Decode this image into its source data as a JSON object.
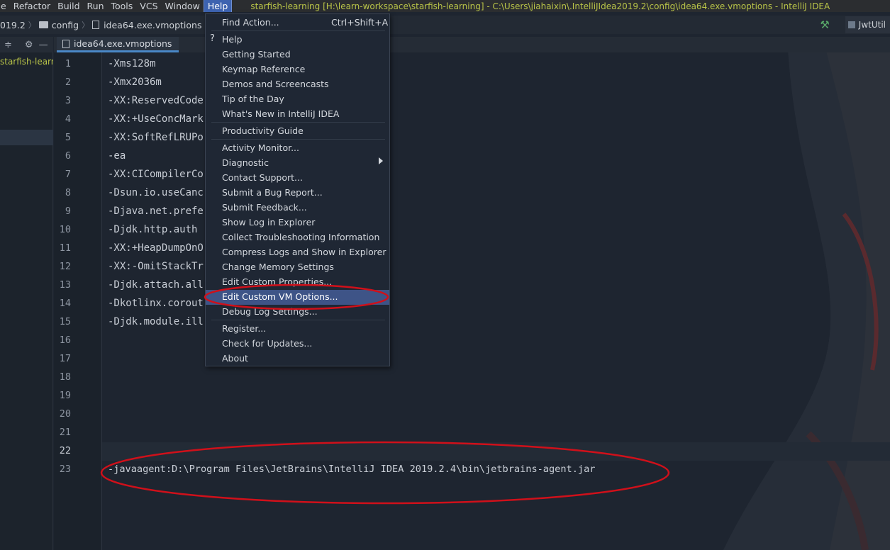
{
  "menubar": {
    "items": [
      "e",
      "Refactor",
      "Build",
      "Run",
      "Tools",
      "VCS",
      "Window",
      "Help"
    ],
    "window_title": "starfish-learning [H:\\learn-workspace\\starfish-learning] - C:\\Users\\jiahaixin\\.IntelliJIdea2019.2\\config\\idea64.exe.vmoptions - IntelliJ IDEA"
  },
  "breadcrumb": {
    "items": [
      "019.2",
      "config",
      "idea64.exe.vmoptions"
    ]
  },
  "toolbar": {
    "run_config": "JwtUtil"
  },
  "project_panel": {
    "root_label": "starfish-learning"
  },
  "editor": {
    "tab_label": "idea64.exe.vmoptions",
    "lines": [
      {
        "n": "1",
        "text": "-Xms128m"
      },
      {
        "n": "2",
        "text": "-Xmx2036m"
      },
      {
        "n": "3",
        "text": "-XX:ReservedCode"
      },
      {
        "n": "4",
        "text": "-XX:+UseConcMark"
      },
      {
        "n": "5",
        "text": "-XX:SoftRefLRUPo"
      },
      {
        "n": "6",
        "text": "-ea"
      },
      {
        "n": "7",
        "text": "-XX:CICompilerCo"
      },
      {
        "n": "8",
        "text": "-Dsun.io.useCanc"
      },
      {
        "n": "9",
        "text": "-Djava.net.prefe"
      },
      {
        "n": "10",
        "text": "-Djdk.http.auth"
      },
      {
        "n": "11",
        "text": "-XX:+HeapDumpOnO"
      },
      {
        "n": "12",
        "text": "-XX:-OmitStackTr"
      },
      {
        "n": "13",
        "text": "-Djdk.attach.all"
      },
      {
        "n": "14",
        "text": "-Dkotlinx.corout"
      },
      {
        "n": "15",
        "text": "-Djdk.module.ill"
      },
      {
        "n": "16",
        "text": ""
      },
      {
        "n": "17",
        "text": ""
      },
      {
        "n": "18",
        "text": ""
      },
      {
        "n": "19",
        "text": ""
      },
      {
        "n": "20",
        "text": ""
      },
      {
        "n": "21",
        "text": ""
      },
      {
        "n": "22",
        "text": ""
      },
      {
        "n": "23",
        "text": "-javaagent:D:\\Program Files\\JetBrains\\IntelliJ IDEA 2019.2.4\\bin\\jetbrains-agent.jar"
      }
    ]
  },
  "help_menu": {
    "find_action": "Find Action...",
    "find_action_shortcut": "Ctrl+Shift+A",
    "items": [
      "Help",
      "Getting Started",
      "Keymap Reference",
      "Demos and Screencasts",
      "Tip of the Day",
      "What's New in IntelliJ IDEA",
      "Productivity Guide",
      "Activity Monitor...",
      "Diagnostic",
      "Contact Support...",
      "Submit a Bug Report...",
      "Submit Feedback...",
      "Show Log in Explorer",
      "Collect Troubleshooting Information",
      "Compress Logs and Show in Explorer",
      "Change Memory Settings",
      "Edit Custom Properties...",
      "Edit Custom VM Options...",
      "Debug Log Settings...",
      "Register...",
      "Check for Updates...",
      "About"
    ],
    "selected_item": "Edit Custom VM Options..."
  },
  "colors": {
    "annotation": "#d0101a",
    "menu_selection": "#3e5487",
    "title_text": "#b9c448"
  }
}
